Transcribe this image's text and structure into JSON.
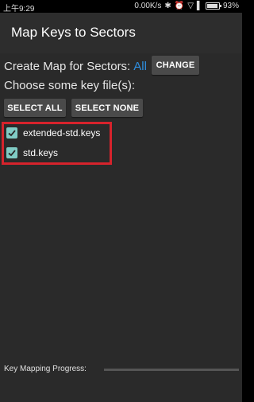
{
  "statusbar": {
    "time": "上午9:29",
    "netspeed": "0.00K/s",
    "battery": "93%",
    "battery_level": 0.93
  },
  "app": {
    "title": "Map Keys to Sectors"
  },
  "sectors": {
    "label": "Create Map for Sectors:",
    "value": "All",
    "change_label": "CHANGE"
  },
  "keys": {
    "prompt": "Choose some key file(s):",
    "select_all_label": "SELECT ALL",
    "select_none_label": "SELECT NONE",
    "files": [
      {
        "name": "extended-std.keys",
        "checked": true
      },
      {
        "name": "std.keys",
        "checked": true
      }
    ]
  },
  "progress": {
    "label": "Key Mapping Progress:",
    "value": 0
  },
  "colors": {
    "accent": "#80cbc4",
    "link": "#2f8fe0",
    "highlight_box": "#d6232c"
  }
}
